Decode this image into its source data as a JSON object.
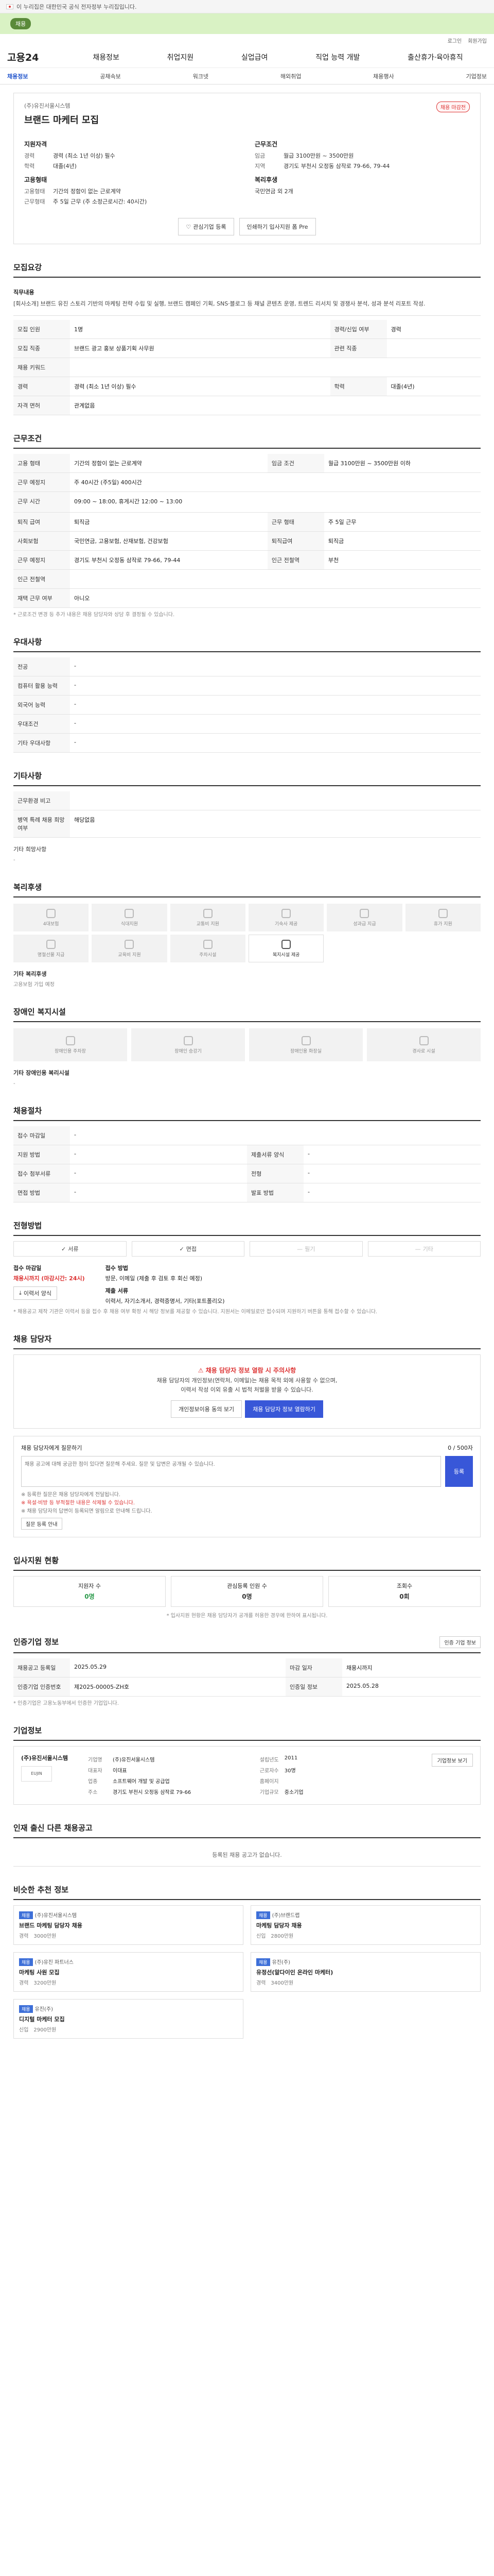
{
  "gov_banner": "이 누리집은 대한민국 공식 전자정부 누리집입니다.",
  "promo": {
    "pill": "채용"
  },
  "util": [
    "로그인",
    "회원가입"
  ],
  "header": {
    "logo": "고용24",
    "gnb": [
      "채용정보",
      "취업지원",
      "실업급여",
      "직업 능력 개발",
      "출산휴가·육아휴직"
    ]
  },
  "lnb": {
    "items": [
      "채용정보",
      "공채속보",
      "워크넷",
      "해외취업",
      "채용행사",
      "기업정보"
    ],
    "active": 0
  },
  "job": {
    "company": "(주)유진서울시스템",
    "title": "브랜드 마케터 모집",
    "badge": "채용 마감전",
    "summary": {
      "left_title": "지원자격",
      "left_rows": [
        {
          "k": "경력",
          "v": "경력 (최소 1년 이상) 필수"
        },
        {
          "k": "학력",
          "v": "대졸(4년)"
        }
      ],
      "left2_title": "고용형태",
      "left2_rows": [
        {
          "k": "고용형태",
          "v": "기간의 정함이 없는 근로계약"
        },
        {
          "k": "근무형태",
          "v": "주 5일 근무 (주 소정근로시간: 40시간)"
        }
      ],
      "right_title": "근무조건",
      "right_rows": [
        {
          "k": "임금",
          "v": "월급 3100만원 ~ 3500만원"
        },
        {
          "k": "지역",
          "v": "경기도 부천시 오정동 삼작로 79-66, 79-44"
        }
      ],
      "right2_title": "복리후생",
      "right2_rows": [
        {
          "k": "",
          "v": "국민연금 외 2개"
        }
      ]
    },
    "buttons": {
      "apply": "관심기업 등록",
      "scrap": "인쇄하기 입사지원 폼 Pre"
    }
  },
  "sections": {
    "recruit": "모집요강",
    "conditions": "근무조건",
    "preference": "우대사항",
    "etc": "기타사항",
    "welfare": "복리후생",
    "disabled": "장애인 복지시설",
    "process": "채용절차",
    "apply_method": "전형방법",
    "contact": "채용 담당자",
    "status": "입사지원 현황",
    "info": "인증기업 정보",
    "company": "기업정보",
    "other": "인재 출신 다른 채용공고",
    "recommend": "비슷한 추천 정보"
  },
  "recruit": {
    "desc_label": "직무내용",
    "desc": "[회사소개] 브랜드 유진 스토리 기반의 마케팅 전략 수립 및 실행, 브랜드 캠페인 기획, SNS·블로그 등 채널 콘텐츠 운영, 트렌드 리서치 및 경쟁사 분석, 성과 분석 리포트 작성.",
    "rows": [
      [
        {
          "k": "모집 인원",
          "v": "1명"
        },
        {
          "k": "경력/신입 여부",
          "v": "경력"
        }
      ],
      [
        {
          "k": "모집 직종",
          "v": "브랜드 광고 홍보 상품기획 사무원"
        },
        {
          "k": "관련 직종",
          "v": ""
        }
      ],
      [
        {
          "k": "채용 키워드",
          "v": ""
        },
        {
          "k": "",
          "v": ""
        }
      ],
      [
        {
          "k": "경력",
          "v": "경력 (최소 1년 이상) 필수"
        },
        {
          "k": "학력",
          "v": "대졸(4년)"
        }
      ],
      [
        {
          "k": "자격 면허",
          "v": "관계없음"
        },
        {
          "k": "",
          "v": ""
        }
      ]
    ]
  },
  "conditions": {
    "rows": [
      [
        {
          "k": "고용 형태",
          "v": "기간의 정함이 없는 근로계약"
        },
        {
          "k": "임금 조건",
          "v": "월급 3100만원 ~ 3500만원 이하"
        }
      ],
      [
        {
          "k": "근무 예정지",
          "v": "주 40시간 (주5일) 400시간"
        },
        {
          "k": "",
          "v": ""
        }
      ],
      [
        {
          "k": "근무 시간",
          "v": "09:00 ~ 18:00, 휴게시간 12:00 ~ 13:00"
        },
        {
          "k": "",
          "v": ""
        }
      ],
      [
        {
          "k": "퇴직 급여",
          "v": "퇴직금"
        },
        {
          "k": "근무 형태",
          "v": "주 5일 근무"
        }
      ],
      [
        {
          "k": "사회보험",
          "v": "국민연금, 고용보험, 산재보험, 건강보험"
        },
        {
          "k": "퇴직급여",
          "v": "퇴직금"
        }
      ],
      [
        {
          "k": "근무 예정지",
          "v": "경기도 부천시 오정동 삼작로 79-66, 79-44"
        },
        {
          "k": "인근 전철역",
          "v": "부천"
        }
      ],
      [
        {
          "k": "인근 전철역",
          "v": ""
        },
        {
          "k": "",
          "v": ""
        }
      ],
      [
        {
          "k": "재택 근무 여부",
          "v": "아니오"
        },
        {
          "k": "",
          "v": ""
        }
      ]
    ],
    "note": "* 근로조건 변경 등 추가 내용은 채용 담당자와 상담 후 결정될 수 있습니다."
  },
  "preference": {
    "rows": [
      {
        "k": "전공",
        "v": "-"
      },
      {
        "k": "컴퓨터 활용 능력",
        "v": "-"
      },
      {
        "k": "외국어 능력",
        "v": "-"
      },
      {
        "k": "우대조건",
        "v": "-"
      },
      {
        "k": "기타 우대사항",
        "v": "-"
      }
    ]
  },
  "etc": {
    "rows": [
      {
        "k": "근무환경 비고",
        "v": ""
      },
      {
        "k": "병역 특례 채용 희망 여부",
        "v": "해당없음"
      }
    ],
    "extra_label": "기타 희망사항",
    "extra_value": "-"
  },
  "welfare": {
    "items": [
      {
        "icon": "insurance-icon",
        "label": "4대보험"
      },
      {
        "icon": "meal-icon",
        "label": "식대지원"
      },
      {
        "icon": "transport-icon",
        "label": "교통비 지원"
      },
      {
        "icon": "dorm-icon",
        "label": "기숙사 제공"
      },
      {
        "icon": "bonus-icon",
        "label": "성과급 지급"
      },
      {
        "icon": "vacation-icon",
        "label": "휴가 지원"
      },
      {
        "icon": "gift-icon",
        "label": "명절선물 지급"
      },
      {
        "icon": "education-icon",
        "label": "교육비 지원"
      },
      {
        "icon": "car-icon",
        "label": "주차시설"
      },
      {
        "icon": "rest-icon",
        "label": "복지시설 제공"
      }
    ],
    "active_index": 9,
    "other_label": "기타 복리후생",
    "other_value": "고용보험 가입 예정"
  },
  "disabled": {
    "items": [
      {
        "icon": "wheelchair-icon",
        "label": "장애인용 주차장"
      },
      {
        "icon": "elevator-icon",
        "label": "장애인 승강기"
      },
      {
        "icon": "toilet-icon",
        "label": "장애인용 화장실"
      },
      {
        "icon": "ramp-icon",
        "label": "경사로 시설"
      }
    ],
    "other_label": "기타 장애인용 복리시설",
    "other_value": "-"
  },
  "process": {
    "rows": [
      [
        {
          "k": "접수 마감일",
          "v": "-"
        },
        {
          "k": "",
          "v": ""
        }
      ],
      [
        {
          "k": "지원 방법",
          "v": "-"
        },
        {
          "k": "제출서류 양식",
          "v": "-"
        }
      ],
      [
        {
          "k": "접수 첨부서류",
          "v": "-"
        },
        {
          "k": "전형",
          "v": "-"
        }
      ],
      [
        {
          "k": "면접 방법",
          "v": "-"
        },
        {
          "k": "발표 방법",
          "v": "-"
        }
      ]
    ]
  },
  "apply_method": {
    "items": [
      {
        "label": "서류",
        "on": true
      },
      {
        "label": "면접",
        "on": true
      },
      {
        "label": "필기",
        "on": false
      },
      {
        "label": "기타",
        "on": false
      }
    ],
    "deadline_label": "접수 마감일",
    "deadline_value": "채용시까지 (마감시간: 24시)",
    "method_label": "접수 방법",
    "method_value": "방문, 이메일 (제출 후 검토 후 회신 예정)",
    "docs_label": "제출 서류",
    "docs_value": "이력서, 자기소개서, 경력증명서, 기타(포트폴리오)",
    "template_btn": "이력서 양식",
    "notes": "* 채용공고 제작 기관은 이력서 등을 접수 후 채용 여부 확정 시 해당 정보를 제공할 수 있습니다. 지원서는 이메일로만 접수되며 지원하기 버튼을 통해 접수할 수 있습니다."
  },
  "contact": {
    "alert": "채용 담당자 정보 열람 시 주의사항",
    "line1": "채용 담당자의 개인정보(연락처, 이메일)는 채용 목적 외에 사용할 수 없으며,",
    "line2": "이력서 작성 이외 유출 시 법적 처벌을 받을 수 있습니다.",
    "btn1": "개인정보이용 동의 보기",
    "btn2": "채용 담당자 정보 열람하기"
  },
  "qna": {
    "title": "채용 담당자에게 질문하기",
    "counter": "0 / 500자",
    "placeholder": "채용 공고에 대해 궁금한 점이 있다면 질문해 주세요. 질문 및 답변은 공개될 수 있습니다.",
    "submit": "등록",
    "note1": "※ 등록한 질문은 채용 담당자에게 전달됩니다.",
    "note2": "※ 욕설·비방 등 부적절한 내용은 삭제될 수 있습니다.",
    "note3": "※ 채용 담당자의 답변이 등록되면 알림으로 안내해 드립니다.",
    "qna_btn": "질문 등록 안내"
  },
  "status": {
    "items": [
      {
        "label": "지원자 수",
        "value": "0명",
        "green": true
      },
      {
        "label": "관심등록 인원 수",
        "value": "0명",
        "green": false
      },
      {
        "label": "조회수",
        "value": "0회",
        "green": false
      }
    ],
    "note": "* 입사지원 현황은 채용 담당자가 공개를 허용한 경우에 한하여 표시됩니다."
  },
  "info": {
    "rows": [
      [
        {
          "k": "채용공고 등록일",
          "v": "2025.05.29"
        },
        {
          "k": "마감 일자",
          "v": "채용시까지"
        }
      ],
      [
        {
          "k": "인증기업 인증번호",
          "v": "제2025-00005-ZH호"
        },
        {
          "k": "인증일 정보",
          "v": "2025.05.28"
        }
      ]
    ],
    "note": "* 인증기업은 고용노동부에서 인증한 기업입니다.",
    "right_btn": "인증 기업 정보"
  },
  "company": {
    "name": "(주)유진서울시스템",
    "logo_text": "EUJIN",
    "btn": "기업정보 보기",
    "rows_left": [
      {
        "k": "기업명",
        "v": "(주)유진서울시스템"
      },
      {
        "k": "대표자",
        "v": "이대표"
      },
      {
        "k": "업종",
        "v": "소프트웨어 개발 및 공급업"
      },
      {
        "k": "주소",
        "v": "경기도 부천시 오정동 삼작로 79-66"
      }
    ],
    "rows_right": [
      {
        "k": "설립년도",
        "v": "2011"
      },
      {
        "k": "근로자수",
        "v": "30명"
      },
      {
        "k": "홈페이지",
        "v": ""
      },
      {
        "k": "기업규모",
        "v": "중소기업"
      }
    ]
  },
  "other": {
    "empty": "등록된 채용 공고가 없습니다."
  },
  "recommend": {
    "items": [
      {
        "badge": "채용",
        "company": "(주)유진서울시스템",
        "title": "브랜드 마케팅 담당자 채용",
        "meta": [
          "경력",
          "3000만원"
        ]
      },
      {
        "badge": "채용",
        "company": "(주)브랜드랩",
        "title": "마케팅 담당자 채용",
        "meta": [
          "신입",
          "2800만원"
        ]
      },
      {
        "badge": "채용",
        "company": "(주)유진 파트너스",
        "title": "마케팅 사원 모집",
        "meta": [
          "경력",
          "3200만원"
        ]
      },
      {
        "badge": "채용",
        "company": "유진(주)",
        "title": "유정선(알다이인 온라인 마케터)",
        "meta": [
          "경력",
          "3400만원"
        ]
      },
      {
        "badge": "채용",
        "company": "유진(주)",
        "title": "디지털 마케터 모집",
        "meta": [
          "신입",
          "2900만원"
        ]
      }
    ]
  }
}
